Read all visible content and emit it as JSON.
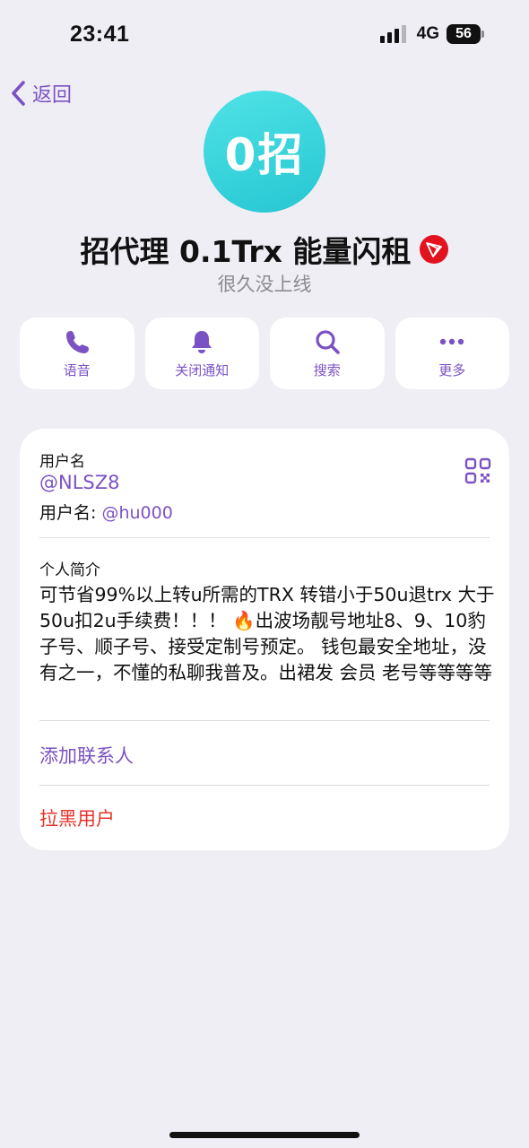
{
  "status_bar": {
    "time": "23:41",
    "network": "4G",
    "battery": "56"
  },
  "nav": {
    "back_label": "返回"
  },
  "profile": {
    "avatar_text": "0招",
    "name": "招代理 0.1Trx 能量闪租",
    "status": "很久没上线",
    "avatar_color": "#2ccbd6",
    "badge_color": "#e3121f"
  },
  "actions": [
    {
      "label": "语音",
      "icon": "phone-icon"
    },
    {
      "label": "关闭通知",
      "icon": "bell-icon"
    },
    {
      "label": "搜索",
      "icon": "search-icon"
    },
    {
      "label": "更多",
      "icon": "more-icon"
    }
  ],
  "info": {
    "username_label": "用户名",
    "username_value": "@NLSZ8",
    "username_alt_label": "用户名: ",
    "username_alt_value": "@hu000",
    "bio_label": "个人简介",
    "bio_text": "可节省99%以上转u所需的TRX 转错小于50u退trx 大于50u扣2u手续费！！！ 🔥出波场靓号地址8、9、10豹子号、顺子号、接受定制号预定。 钱包最安全地址，没有之一，不懂的私聊我普及。出裙发 会员 老号等等等等",
    "add_contact": "添加联系人",
    "block_user": "拉黑用户"
  },
  "colors": {
    "accent": "#7b52c4",
    "danger": "#e5342b",
    "background": "#efeef5"
  }
}
